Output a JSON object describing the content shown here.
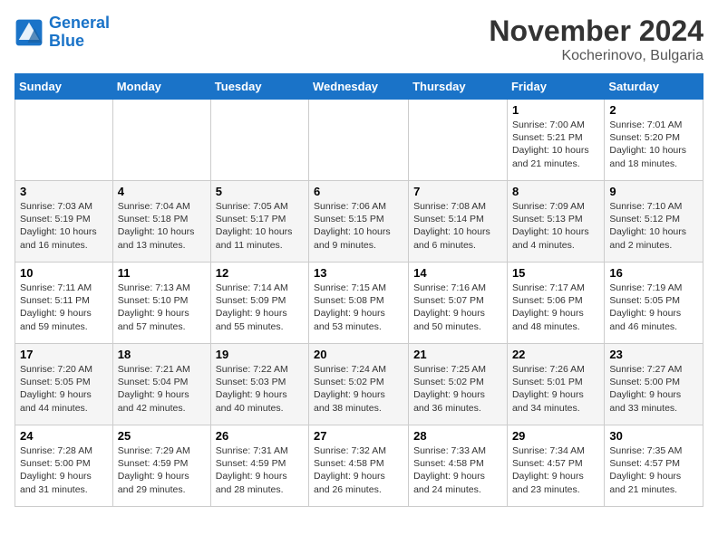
{
  "logo": {
    "line1": "General",
    "line2": "Blue"
  },
  "title": "November 2024",
  "location": "Kocherinovo, Bulgaria",
  "days_header": [
    "Sunday",
    "Monday",
    "Tuesday",
    "Wednesday",
    "Thursday",
    "Friday",
    "Saturday"
  ],
  "weeks": [
    [
      {
        "day": "",
        "info": ""
      },
      {
        "day": "",
        "info": ""
      },
      {
        "day": "",
        "info": ""
      },
      {
        "day": "",
        "info": ""
      },
      {
        "day": "",
        "info": ""
      },
      {
        "day": "1",
        "info": "Sunrise: 7:00 AM\nSunset: 5:21 PM\nDaylight: 10 hours and 21 minutes."
      },
      {
        "day": "2",
        "info": "Sunrise: 7:01 AM\nSunset: 5:20 PM\nDaylight: 10 hours and 18 minutes."
      }
    ],
    [
      {
        "day": "3",
        "info": "Sunrise: 7:03 AM\nSunset: 5:19 PM\nDaylight: 10 hours and 16 minutes."
      },
      {
        "day": "4",
        "info": "Sunrise: 7:04 AM\nSunset: 5:18 PM\nDaylight: 10 hours and 13 minutes."
      },
      {
        "day": "5",
        "info": "Sunrise: 7:05 AM\nSunset: 5:17 PM\nDaylight: 10 hours and 11 minutes."
      },
      {
        "day": "6",
        "info": "Sunrise: 7:06 AM\nSunset: 5:15 PM\nDaylight: 10 hours and 9 minutes."
      },
      {
        "day": "7",
        "info": "Sunrise: 7:08 AM\nSunset: 5:14 PM\nDaylight: 10 hours and 6 minutes."
      },
      {
        "day": "8",
        "info": "Sunrise: 7:09 AM\nSunset: 5:13 PM\nDaylight: 10 hours and 4 minutes."
      },
      {
        "day": "9",
        "info": "Sunrise: 7:10 AM\nSunset: 5:12 PM\nDaylight: 10 hours and 2 minutes."
      }
    ],
    [
      {
        "day": "10",
        "info": "Sunrise: 7:11 AM\nSunset: 5:11 PM\nDaylight: 9 hours and 59 minutes."
      },
      {
        "day": "11",
        "info": "Sunrise: 7:13 AM\nSunset: 5:10 PM\nDaylight: 9 hours and 57 minutes."
      },
      {
        "day": "12",
        "info": "Sunrise: 7:14 AM\nSunset: 5:09 PM\nDaylight: 9 hours and 55 minutes."
      },
      {
        "day": "13",
        "info": "Sunrise: 7:15 AM\nSunset: 5:08 PM\nDaylight: 9 hours and 53 minutes."
      },
      {
        "day": "14",
        "info": "Sunrise: 7:16 AM\nSunset: 5:07 PM\nDaylight: 9 hours and 50 minutes."
      },
      {
        "day": "15",
        "info": "Sunrise: 7:17 AM\nSunset: 5:06 PM\nDaylight: 9 hours and 48 minutes."
      },
      {
        "day": "16",
        "info": "Sunrise: 7:19 AM\nSunset: 5:05 PM\nDaylight: 9 hours and 46 minutes."
      }
    ],
    [
      {
        "day": "17",
        "info": "Sunrise: 7:20 AM\nSunset: 5:05 PM\nDaylight: 9 hours and 44 minutes."
      },
      {
        "day": "18",
        "info": "Sunrise: 7:21 AM\nSunset: 5:04 PM\nDaylight: 9 hours and 42 minutes."
      },
      {
        "day": "19",
        "info": "Sunrise: 7:22 AM\nSunset: 5:03 PM\nDaylight: 9 hours and 40 minutes."
      },
      {
        "day": "20",
        "info": "Sunrise: 7:24 AM\nSunset: 5:02 PM\nDaylight: 9 hours and 38 minutes."
      },
      {
        "day": "21",
        "info": "Sunrise: 7:25 AM\nSunset: 5:02 PM\nDaylight: 9 hours and 36 minutes."
      },
      {
        "day": "22",
        "info": "Sunrise: 7:26 AM\nSunset: 5:01 PM\nDaylight: 9 hours and 34 minutes."
      },
      {
        "day": "23",
        "info": "Sunrise: 7:27 AM\nSunset: 5:00 PM\nDaylight: 9 hours and 33 minutes."
      }
    ],
    [
      {
        "day": "24",
        "info": "Sunrise: 7:28 AM\nSunset: 5:00 PM\nDaylight: 9 hours and 31 minutes."
      },
      {
        "day": "25",
        "info": "Sunrise: 7:29 AM\nSunset: 4:59 PM\nDaylight: 9 hours and 29 minutes."
      },
      {
        "day": "26",
        "info": "Sunrise: 7:31 AM\nSunset: 4:59 PM\nDaylight: 9 hours and 28 minutes."
      },
      {
        "day": "27",
        "info": "Sunrise: 7:32 AM\nSunset: 4:58 PM\nDaylight: 9 hours and 26 minutes."
      },
      {
        "day": "28",
        "info": "Sunrise: 7:33 AM\nSunset: 4:58 PM\nDaylight: 9 hours and 24 minutes."
      },
      {
        "day": "29",
        "info": "Sunrise: 7:34 AM\nSunset: 4:57 PM\nDaylight: 9 hours and 23 minutes."
      },
      {
        "day": "30",
        "info": "Sunrise: 7:35 AM\nSunset: 4:57 PM\nDaylight: 9 hours and 21 minutes."
      }
    ]
  ]
}
